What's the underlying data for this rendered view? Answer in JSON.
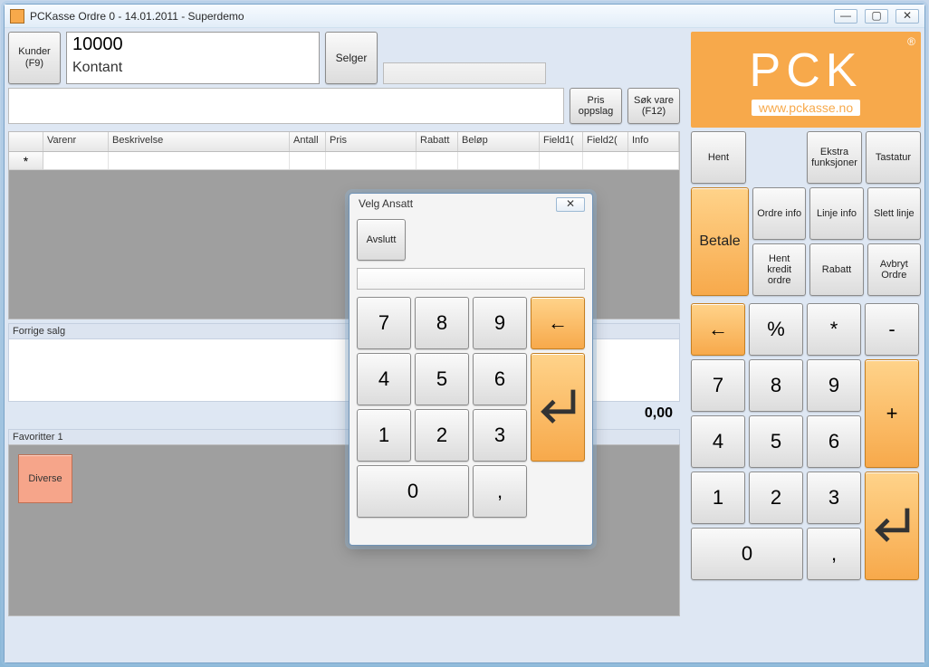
{
  "window": {
    "title": "PCKasse Ordre 0 - 14.01.2011 - Superdemo"
  },
  "top": {
    "kunder_label": "Kunder\n(F9)",
    "customer_nr": "10000",
    "customer_name": "Kontant",
    "selger_label": "Selger",
    "pris_oppslag": "Pris\noppslag",
    "sok_vare": "Søk vare\n(F12)"
  },
  "grid": {
    "cols": [
      "",
      "Varenr",
      "Beskrivelse",
      "Antall",
      "Pris",
      "Rabatt",
      "Beløp",
      "Field1(",
      "Field2(",
      "Info"
    ],
    "rowmark": "*"
  },
  "panels": {
    "forrige_salg": "Forrige salg",
    "total": "0,00",
    "favoritter": "Favoritter 1",
    "diverse": "Diverse"
  },
  "logo": {
    "text": "PCK",
    "url": "www.pckasse.no",
    "reg": "®"
  },
  "right": {
    "hent": "Hent",
    "ekstra": "Ekstra\nfunksjoner",
    "tastatur": "Tastatur",
    "betale": "Betale",
    "ordre_info": "Ordre info",
    "linje_info": "Linje info",
    "slett_linje": "Slett linje",
    "hent_kredit": "Hent\nkredit\nordre",
    "rabatt": "Rabatt",
    "avbryt_ordre": "Avbryt\nOrdre"
  },
  "numpad": {
    "back": "←",
    "pct": "%",
    "star": "*",
    "minus": "-",
    "n7": "7",
    "n8": "8",
    "n9": "9",
    "plus": "+",
    "n4": "4",
    "n5": "5",
    "n6": "6",
    "n1": "1",
    "n2": "2",
    "n3": "3",
    "enter": "↵",
    "n0": "0",
    "comma": ","
  },
  "dialog": {
    "title": "Velg Ansatt",
    "avslutt": "Avslutt",
    "close": "✕",
    "keys": {
      "n7": "7",
      "n8": "8",
      "n9": "9",
      "back": "←",
      "n4": "4",
      "n5": "5",
      "n6": "6",
      "enter": "↵",
      "n1": "1",
      "n2": "2",
      "n3": "3",
      "n0": "0",
      "comma": ","
    }
  }
}
